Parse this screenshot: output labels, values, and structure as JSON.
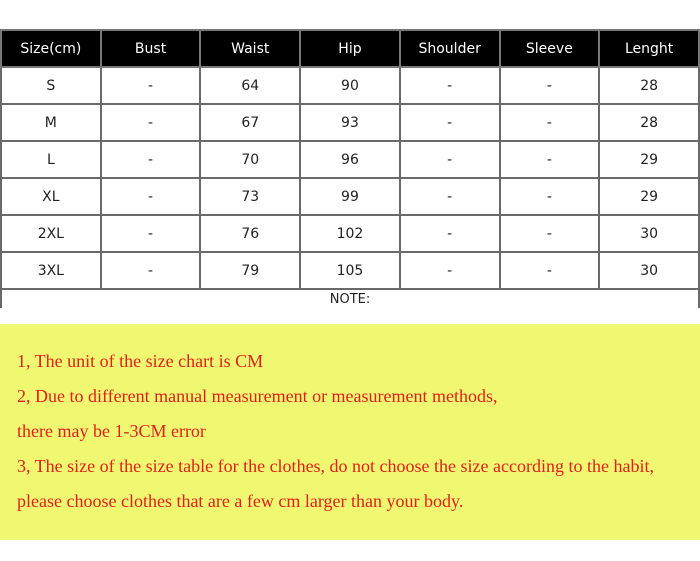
{
  "headers": [
    "Size(cm)",
    "Bust",
    "Waist",
    "Hip",
    "Shoulder",
    "Sleeve",
    "Lenght"
  ],
  "rows": [
    [
      "S",
      "-",
      "64",
      "90",
      "-",
      "-",
      "28"
    ],
    [
      "M",
      "-",
      "67",
      "93",
      "-",
      "-",
      "28"
    ],
    [
      "L",
      "-",
      "70",
      "96",
      "-",
      "-",
      "29"
    ],
    [
      "XL",
      "-",
      "73",
      "99",
      "-",
      "-",
      "29"
    ],
    [
      "2XL",
      "-",
      "76",
      "102",
      "-",
      "-",
      "30"
    ],
    [
      "3XL",
      "-",
      "79",
      "105",
      "-",
      "-",
      "30"
    ]
  ],
  "note_label": "NOTE:",
  "notes": [
    "1, The unit of the size chart is CM",
    "2, Due to different manual measurement or measurement methods,",
    "there may be 1-3CM error",
    "3, The size of the size table for the clothes, do not choose the size according to the habit,",
    "please choose clothes that are a few cm larger than your body."
  ],
  "colors": {
    "note_background": "#f0f871",
    "note_text": "#e0201c",
    "header_background": "#000000"
  }
}
